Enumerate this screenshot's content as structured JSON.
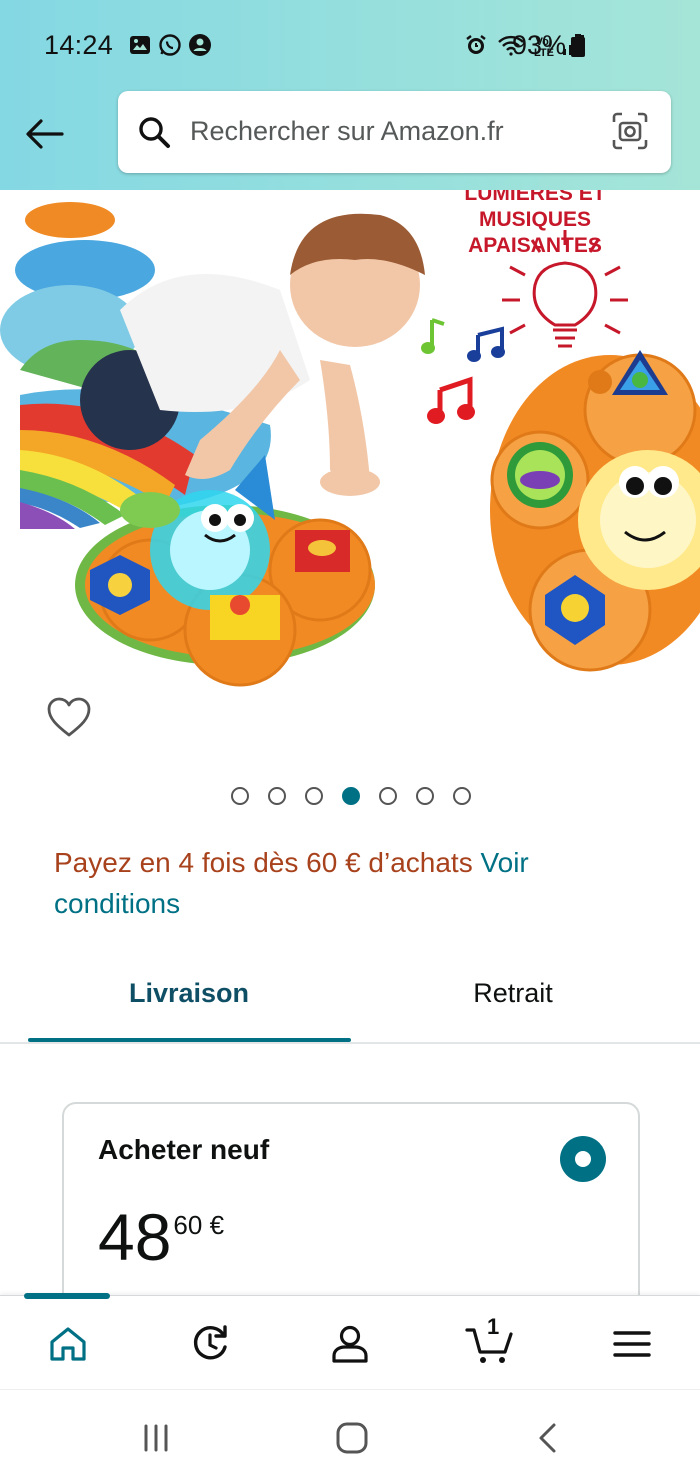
{
  "status_bar": {
    "time": "14:24",
    "battery": "93%",
    "network": "LTE",
    "left_icons": [
      "gallery-icon",
      "whatsapp-icon",
      "account-circle-icon"
    ],
    "right_icons": [
      "alarm-icon",
      "wifi-icon",
      "volte-icon",
      "signal-icon",
      "battery-icon"
    ]
  },
  "header": {
    "search_placeholder": "Rechercher sur Amazon.fr",
    "back_icon": "back-arrow-icon",
    "camera_icon": "camera-lens-icon",
    "gradient_start": "#84d8e3",
    "gradient_end": "#a5e5d8"
  },
  "product": {
    "image_caption": "LUMIÈRES ET MUSIQUES APAISANTES",
    "image_caption_lines": [
      "LUMIERES ET",
      "MUSIQUES",
      "APAISANTES"
    ],
    "carousel": {
      "total": 7,
      "active_index": 3
    }
  },
  "installments": {
    "promo_text": "Payez en 4 fois dès 60 € d’achats",
    "link_text": "Voir conditions"
  },
  "tabs": [
    {
      "label": "Livraison",
      "active": true
    },
    {
      "label": "Retrait",
      "active": false
    }
  ],
  "buy_option": {
    "title": "Acheter neuf",
    "price_whole": "48",
    "price_fraction": "60 €",
    "selected": true
  },
  "bottom_nav": {
    "items": [
      "home-icon",
      "updates-icon",
      "account-icon",
      "cart-icon",
      "menu-icon"
    ],
    "cart_count": "1",
    "active": "home"
  },
  "colors": {
    "accent": "#007185",
    "promo": "#a8421c",
    "text": "#0f1111"
  }
}
